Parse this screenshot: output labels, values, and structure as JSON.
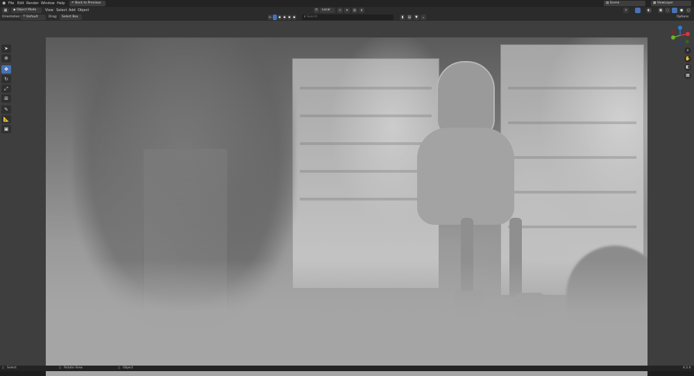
{
  "menubar": {
    "items": [
      "File",
      "Edit",
      "Render",
      "Window",
      "Help"
    ],
    "back_button": "Back to Previous",
    "scene_label": "Scene",
    "view_layer_label": "ViewLayer"
  },
  "header": {
    "mode": "Object Mode",
    "menus": [
      "View",
      "Select",
      "Add",
      "Object"
    ],
    "orientation": "Local",
    "search_placeholder": "Search"
  },
  "tool_settings": {
    "orientation_label": "Orientation:",
    "orientation_value": "Default",
    "drag_label": "Drag:",
    "drag_value": "Select Box",
    "options_label": "Options"
  },
  "statusbar": {
    "left": "Select",
    "middle": "Rotate View",
    "right": "Object",
    "version": "4.2.0"
  },
  "colors": {
    "accent": "#4772b3",
    "axis_x": "#e0323a",
    "axis_y": "#6fb12a",
    "axis_z": "#2e7bd6"
  },
  "icons": {
    "blender": "blender-logo-icon",
    "cursor": "select-cursor-icon",
    "move": "move-icon",
    "rotate": "rotate-icon",
    "scale": "scale-icon",
    "transform": "transform-icon",
    "annotate": "annotate-icon",
    "measure": "measure-icon",
    "add_cube": "add-cube-icon",
    "zoom": "zoom-icon",
    "hand": "pan-hand-icon",
    "camera": "camera-icon",
    "grid": "grid-icon"
  }
}
